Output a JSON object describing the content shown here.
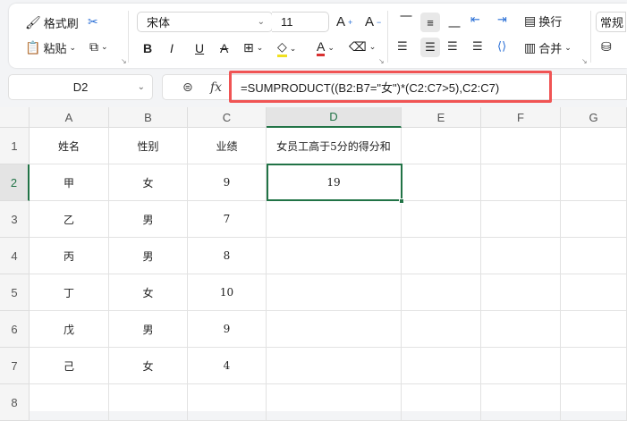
{
  "toolbar": {
    "format_painter": "格式刷",
    "paste": "粘贴",
    "font_name": "宋体",
    "font_size": "11",
    "wrap": "换行",
    "merge": "合并",
    "number_format": "常规"
  },
  "formula_bar": {
    "name_box": "D2",
    "fx": "fx",
    "formula": "=SUMPRODUCT((B2:B7=\"女\")*(C2:C7>5),C2:C7)"
  },
  "columns": [
    "A",
    "B",
    "C",
    "D",
    "E",
    "F",
    "G"
  ],
  "rows": [
    "1",
    "2",
    "3",
    "4",
    "5",
    "6",
    "7",
    "8"
  ],
  "cells": [
    [
      "姓名",
      "性别",
      "业绩",
      "女员工高于5分的得分和"
    ],
    [
      "甲",
      "女",
      "9",
      "19"
    ],
    [
      "乙",
      "男",
      "7",
      ""
    ],
    [
      "丙",
      "男",
      "8",
      ""
    ],
    [
      "丁",
      "女",
      "10",
      ""
    ],
    [
      "戊",
      "男",
      "9",
      ""
    ],
    [
      "己",
      "女",
      "4",
      ""
    ]
  ],
  "selected_cell": "D2",
  "colors": {
    "highlight_border": "#f05454",
    "selection": "#217346"
  }
}
